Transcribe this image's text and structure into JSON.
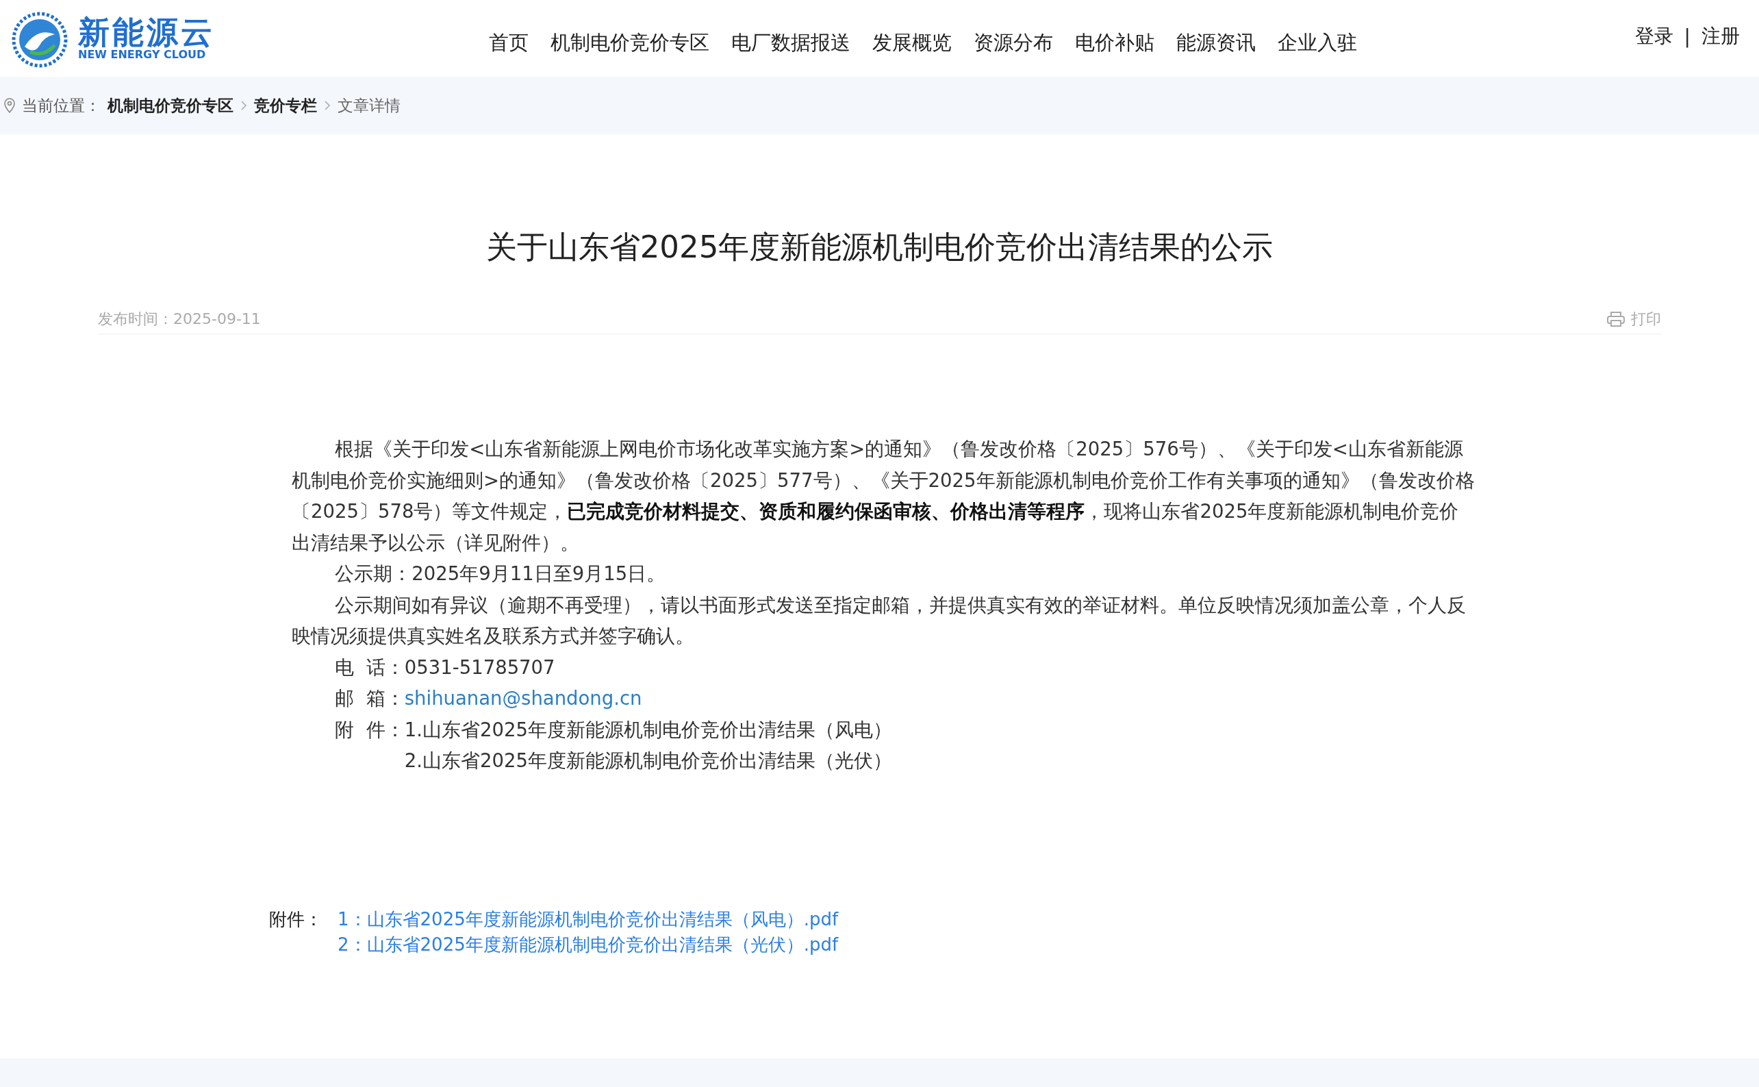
{
  "header": {
    "logo": {
      "name": "新能源云",
      "tagline": "NEW ENERGY CLOUD"
    },
    "nav": [
      {
        "label": "首页"
      },
      {
        "label": "机制电价竞价专区"
      },
      {
        "label": "电厂数据报送"
      },
      {
        "label": "发展概览"
      },
      {
        "label": "资源分布"
      },
      {
        "label": "电价补贴"
      },
      {
        "label": "能源资讯"
      },
      {
        "label": "企业入驻"
      }
    ],
    "auth": {
      "login": "登录",
      "separator": "|",
      "register": "注册"
    }
  },
  "breadcrumb": {
    "prefix": "当前位置：",
    "items": [
      {
        "label": "机制电价竞价专区",
        "kind": "link"
      },
      {
        "label": "竞价专栏",
        "kind": "link"
      },
      {
        "label": "文章详情",
        "kind": "current"
      }
    ]
  },
  "article": {
    "title": "关于山东省2025年度新能源机制电价竞价出清结果的公示",
    "published": "发布时间：2025-09-11",
    "print": "打印",
    "paragraphs": [
      "根据《关于印发<山东省新能源上网电价市场化改革实施方案>的通知》（鲁发改价格〔2025〕576号）、《关于印发<山东省新能源机制电价竞价实施细则>的通知》（鲁发改价格〔2025〕577号）、《关于2025年新能源机制电价竞价工作有关事项的通知》（鲁发改价格〔2025〕578号）等文件规定，**已完成竞价材料提交、资质和履约保函审核、价格出清等程序**，现将山东省2025年度新能源机制电价竞价出清结果予以公示（详见附件）。",
      "公示期：2025年9月11日至9月15日。",
      "公示期间如有异议（逾期不再受理），请以书面形式发送至指定邮箱，并提供真实有效的举证材料。单位反映情况须加盖公章，个人反映情况须提供真实姓名及联系方式并签字确认。"
    ],
    "contacts": [
      {
        "label": "电  话：",
        "value": "0531-51785707",
        "kind": "text"
      },
      {
        "label": "邮  箱：",
        "value": "shihuanan@shandong.cn",
        "kind": "link"
      }
    ],
    "annex": {
      "label": "附  件：",
      "items": [
        "1.山东省2025年度新能源机制电价竞价出清结果（风电）",
        "2.山东省2025年度新能源机制电价竞价出清结果（光伏）"
      ]
    },
    "downloads": {
      "label": "附件：",
      "files": [
        "1：山东省2025年度新能源机制电价竞价出清结果（风电）.pdf",
        "2：山东省2025年度新能源机制电价竞价出清结果（光伏）.pdf"
      ]
    }
  }
}
